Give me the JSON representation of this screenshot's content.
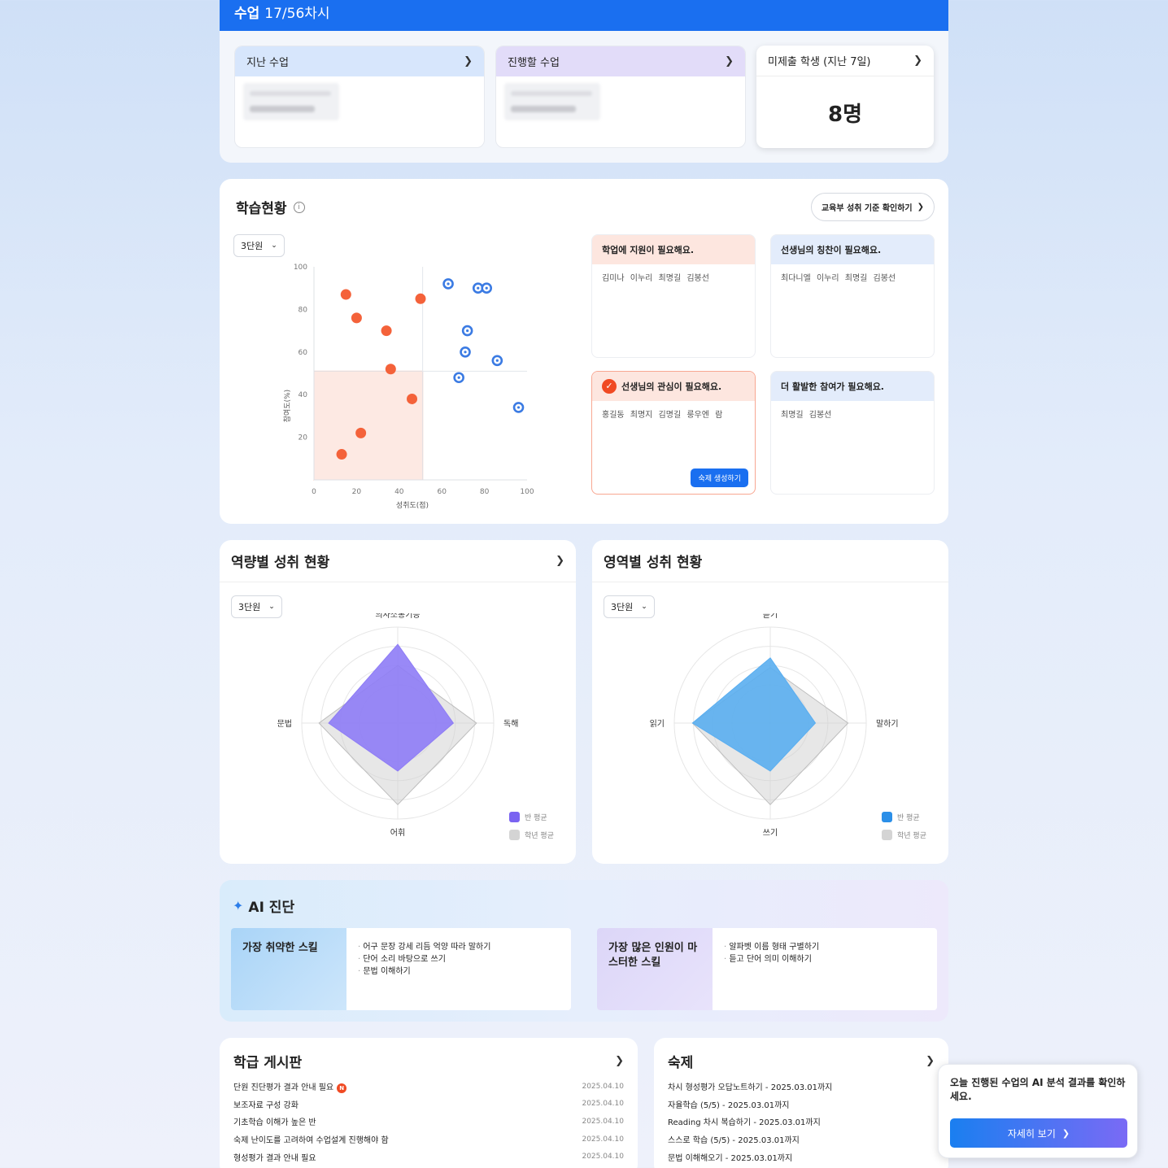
{
  "header": {
    "title": "수업",
    "session": "17/56차시"
  },
  "lessons": {
    "past": {
      "label": "지난 수업"
    },
    "next": {
      "label": "진행할 수업"
    },
    "missing": {
      "label": "미제출 학생 (지난 7일)",
      "count": "8명"
    }
  },
  "learning": {
    "title": "학습현황",
    "standard_button": "교육부 성취 기준 확인하기",
    "unit_select": "3단원",
    "chart_data": {
      "type": "scatter",
      "xlabel": "성취도(점)",
      "ylabel": "참여도(%)",
      "xlim": [
        0,
        100
      ],
      "ylim": [
        0,
        100
      ],
      "x_ticks": [
        "0",
        "20",
        "40",
        "60",
        "80",
        "100"
      ],
      "y_ticks": [
        "20",
        "40",
        "60",
        "80",
        "100"
      ],
      "threshold": {
        "x": 51,
        "y": 51
      },
      "series": [
        {
          "color": "#f4623a",
          "style": "filled",
          "points": [
            [
              15,
              87
            ],
            [
              20,
              76
            ],
            [
              34,
              70
            ],
            [
              50,
              85
            ],
            [
              36,
              52
            ],
            [
              46,
              38
            ],
            [
              22,
              22
            ],
            [
              13,
              12
            ]
          ]
        },
        {
          "color": "#3b7be3",
          "style": "ring",
          "points": [
            [
              63,
              92
            ],
            [
              77,
              90
            ],
            [
              81,
              90
            ],
            [
              72,
              70
            ],
            [
              71,
              60
            ],
            [
              86,
              56
            ],
            [
              68,
              48
            ],
            [
              96,
              34
            ]
          ]
        }
      ]
    },
    "cards": [
      {
        "title": "학업에 지원이 필요해요.",
        "names": "김미나 이누리 최명길 김봉선"
      },
      {
        "title": "선생님의 칭찬이 필요해요.",
        "names": "최다니엘 이누리 최명길 김봉선"
      },
      {
        "title": "선생님의 관심이 필요해요.",
        "names": "홍길동 최명지 김명길 룽우엔 람",
        "button": "숙제 생성하기"
      },
      {
        "title": "더 활발한 참여가 필요해요.",
        "names": "최명길 김봉선"
      }
    ]
  },
  "competency": {
    "title": "역량별 성취 현황",
    "unit_select": "3단원",
    "axes": [
      "의사소통기능",
      "독해",
      "어휘",
      "문법"
    ],
    "class_avg": [
      0.82,
      0.58,
      0.5,
      0.72
    ],
    "grade_avg": [
      0.6,
      0.82,
      0.85,
      0.82
    ],
    "class_color": "#8e7cf6",
    "legend": [
      "반 평균",
      "학년 평균"
    ]
  },
  "domain": {
    "title": "영역별 성취 현황",
    "unit_select": "3단원",
    "axes": [
      "듣기",
      "말하기",
      "쓰기",
      "읽기"
    ],
    "class_avg": [
      0.68,
      0.47,
      0.5,
      0.81
    ],
    "grade_avg": [
      0.58,
      0.81,
      0.85,
      0.81
    ],
    "class_color": "#5aaef0",
    "legend": [
      "반 평균",
      "학년 평균"
    ]
  },
  "ai": {
    "title": "AI 진단",
    "weak": {
      "label": "가장 취약한 스킬",
      "items": [
        "어구 문장 강세 리듬 억양 따라 말하기",
        "단어 소리 바탕으로 쓰기",
        "문법 이해하기"
      ]
    },
    "mastered": {
      "label": "가장 많은 인원이 마스터한 스킬",
      "items": [
        "알파벳 이름 형태 구별하기",
        "듣고 단어 의미 이해하기"
      ]
    }
  },
  "board": {
    "title": "학급 게시판",
    "badge": "N",
    "items": [
      {
        "text": "단원 진단평가 결과 안내 필요",
        "date": "2025.04.10"
      },
      {
        "text": "보조자료 구성 강화",
        "date": "2025.04.10"
      },
      {
        "text": "기초학습 이해가 높은 반",
        "date": "2025.04.10"
      },
      {
        "text": "숙제 난이도를 고려하여 수업설계 진행해야 함",
        "date": "2025.04.10"
      },
      {
        "text": "형성평가 결과 안내 필요",
        "date": "2025.04.10"
      }
    ]
  },
  "homework": {
    "title": "숙제",
    "items": [
      "차시 형성평가 오답노트하기 - 2025.03.01까지",
      "자율학습 (5/5) - 2025.03.01까지",
      "Reading 차시 복습하기 - 2025.03.01까지",
      "스스로 학습 (5/5) - 2025.03.01까지",
      "문법 이해해오기 - 2025.03.01까지"
    ]
  },
  "popup": {
    "message": "오늘 진행된 수업의 AI 분석 결과를 확인하세요.",
    "button": "자세히 보기"
  }
}
